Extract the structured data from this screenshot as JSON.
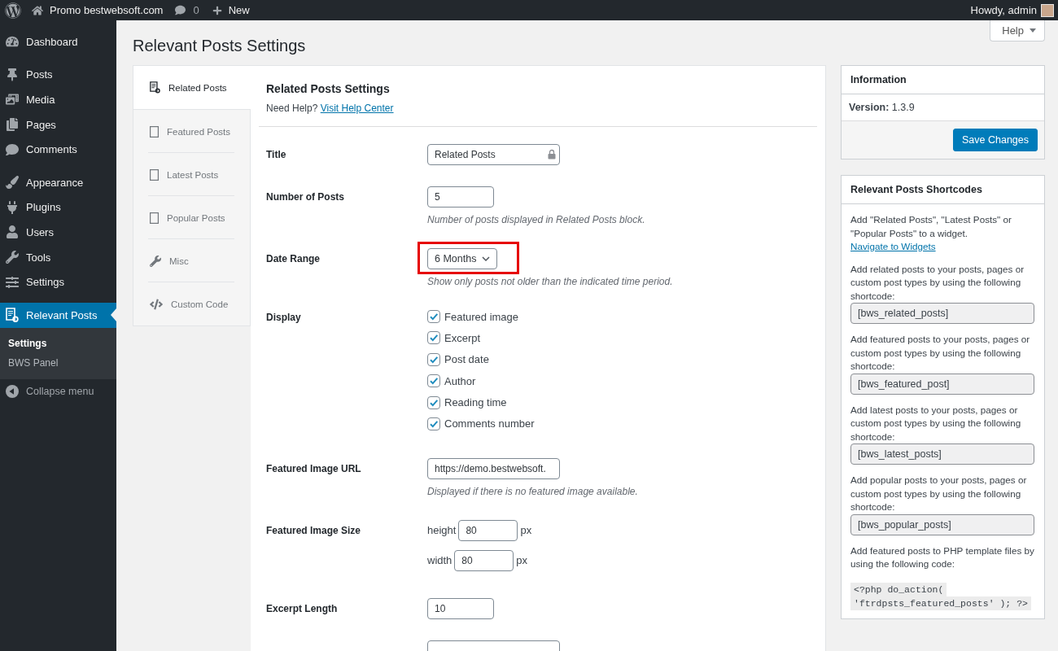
{
  "admin_bar": {
    "site_name": "Promo bestwebsoft.com",
    "comments_count": "0",
    "new_label": "New",
    "greeting": "Howdy, admin"
  },
  "help_tab": {
    "label": "Help"
  },
  "sidebar": {
    "sections": [
      {
        "items": [
          {
            "label": "Dashboard",
            "selected": false,
            "expanded": false
          }
        ]
      },
      {
        "items": [
          {
            "label": "Posts",
            "selected": false,
            "expanded": false
          },
          {
            "label": "Media",
            "selected": false,
            "expanded": false
          },
          {
            "label": "Pages",
            "selected": false,
            "expanded": false
          },
          {
            "label": "Comments",
            "selected": false,
            "expanded": false
          }
        ]
      },
      {
        "items": [
          {
            "label": "Appearance",
            "selected": false,
            "expanded": false
          },
          {
            "label": "Plugins",
            "selected": false,
            "expanded": false
          },
          {
            "label": "Users",
            "selected": false,
            "expanded": false
          },
          {
            "label": "Tools",
            "selected": false,
            "expanded": false
          },
          {
            "label": "Settings",
            "selected": false,
            "expanded": false
          }
        ]
      },
      {
        "items": [
          {
            "label": "Relevant Posts",
            "selected": true,
            "expanded": true,
            "children": [
              {
                "label": "Settings",
                "selected": true
              },
              {
                "label": "BWS Panel",
                "selected": false
              }
            ]
          }
        ]
      }
    ],
    "collapse_label": "Collapse menu"
  },
  "page_title": "Relevant Posts Settings",
  "tabs": [
    {
      "label": "Related Posts",
      "selected": true
    },
    {
      "label": "Featured Posts",
      "selected": false
    },
    {
      "label": "Latest Posts",
      "selected": false
    },
    {
      "label": "Popular Posts",
      "selected": false
    },
    {
      "label": "Misc",
      "selected": false
    },
    {
      "label": "Custom Code",
      "selected": false
    }
  ],
  "form": {
    "title": "Related Posts Settings",
    "help_text": "Need Help?",
    "help_link": "Visit Help Center",
    "rows": [
      {
        "kind": "text",
        "label": "Title",
        "value": "Related Posts",
        "highlighted": false
      },
      {
        "kind": "number",
        "label": "Number of Posts",
        "value": "5",
        "hint": "Number of posts displayed in Related Posts block.",
        "highlighted": false
      },
      {
        "kind": "select",
        "label": "Date Range",
        "value": "6 Months",
        "hint": "Show only posts not older than the indicated time period.",
        "highlighted": true
      },
      {
        "kind": "checkboxes",
        "label": "Display",
        "highlighted": false,
        "options": [
          {
            "label": "Featured image",
            "checked": true
          },
          {
            "label": "Excerpt",
            "checked": true
          },
          {
            "label": "Post date",
            "checked": true
          },
          {
            "label": "Author",
            "checked": true
          },
          {
            "label": "Reading time",
            "checked": true
          },
          {
            "label": "Comments number",
            "checked": true
          }
        ]
      },
      {
        "kind": "text",
        "label": "Featured Image URL",
        "value": "https://demo.bestwebsoft.",
        "hint": "Displayed if there is no featured image available.",
        "highlighted": false
      },
      {
        "kind": "size",
        "label": "Featured Image Size",
        "highlighted": false,
        "fields": [
          {
            "label": "height",
            "value": "80",
            "unit": "px"
          },
          {
            "label": "width",
            "value": "80",
            "unit": "px"
          }
        ]
      },
      {
        "kind": "number",
        "label": "Excerpt Length",
        "value": "10",
        "highlighted": false
      },
      {
        "kind": "text",
        "highlighted": false
      }
    ]
  },
  "information": {
    "title": "Information",
    "version": "**Version:** 1.3.9",
    "button": "Save Changes"
  },
  "shortcodes": {
    "title": "Relevant Posts Shortcodes",
    "intro": "Add \"Related Posts\", \"Latest Posts\" or \"Popular Posts\" to a widget.",
    "intro_link": "Navigate to Widgets",
    "blocks": [
      {
        "text": "Add related posts to your posts, pages or custom post types by using the following shortcode:",
        "shortcode": "[bws_related_posts]"
      },
      {
        "text": "Add featured posts to your posts, pages or custom post types by using the following shortcode:",
        "shortcode": "[bws_featured_post]"
      },
      {
        "text": "Add latest posts to your posts, pages or custom post types by using the following shortcode:",
        "shortcode": "[bws_latest_posts]"
      },
      {
        "text": "Add popular posts to your posts, pages or custom post types by using the following shortcode:",
        "shortcode": "[bws_popular_posts]"
      }
    ],
    "code_note": "Add featured posts to PHP template files by using the following code:",
    "code_lines": [
      "<?php do_action(",
      "'ftrdpsts_featured_posts' ); ?>"
    ]
  }
}
